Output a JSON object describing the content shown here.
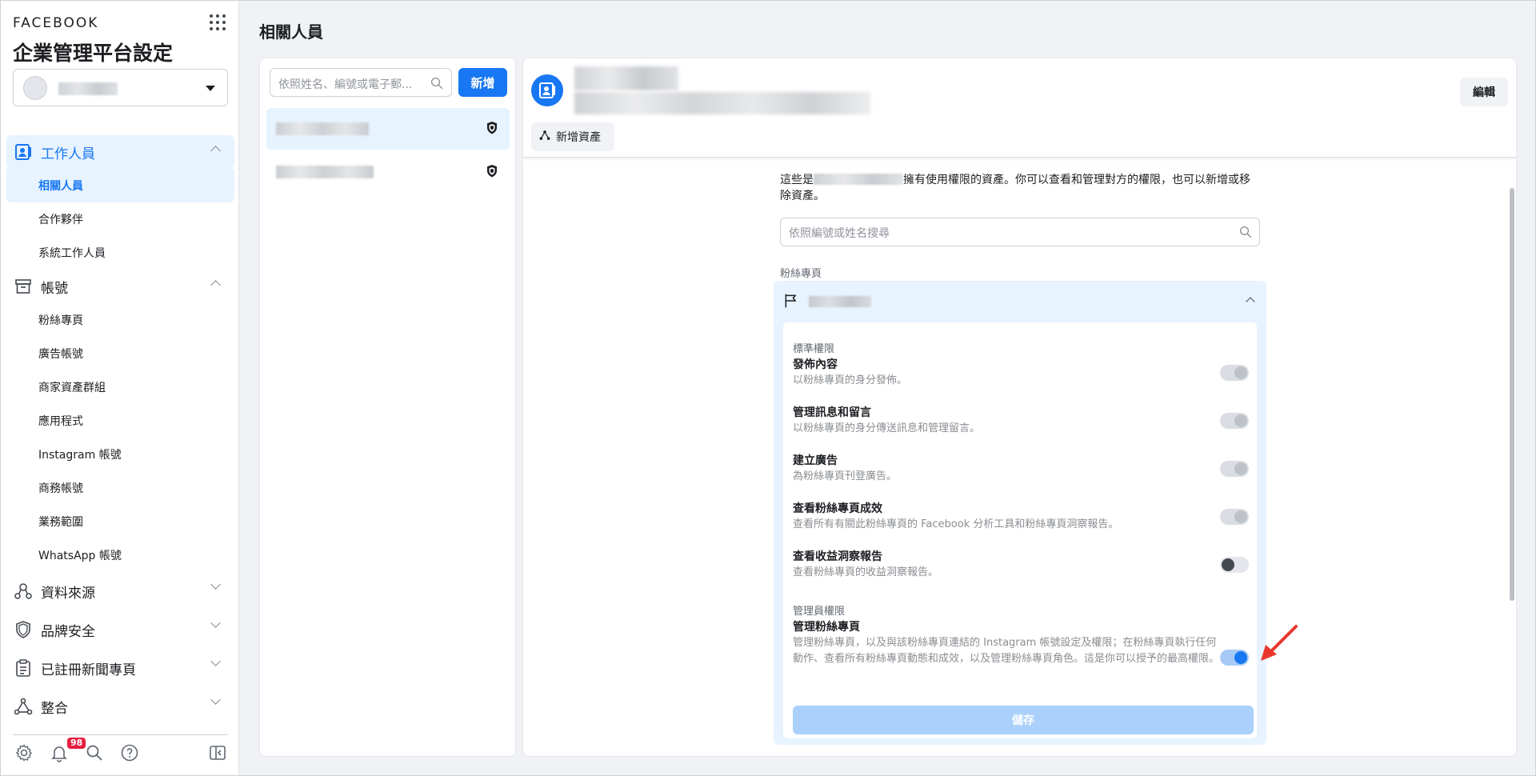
{
  "brand": "FACEBOOK",
  "settings_title": "企業管理平台設定",
  "page_title": "相關人員",
  "sidebar": {
    "groups": [
      {
        "label": "工作人員",
        "expanded": true,
        "items": [
          "相關人員",
          "合作夥伴",
          "系統工作人員"
        ],
        "active_item": "相關人員"
      },
      {
        "label": "帳號",
        "expanded": true,
        "items": [
          "粉絲專頁",
          "廣告帳號",
          "商家資產群組",
          "應用程式",
          "Instagram 帳號",
          "商務帳號",
          "業務範圍",
          "WhatsApp 帳號"
        ]
      },
      {
        "label": "資料來源",
        "expanded": false
      },
      {
        "label": "品牌安全",
        "expanded": false
      },
      {
        "label": "已註冊新聞專頁",
        "expanded": false
      },
      {
        "label": "整合",
        "expanded": false
      }
    ],
    "notification_count": "98"
  },
  "people": {
    "search_placeholder": "依照姓名、編號或電子郵...",
    "add_label": "新增"
  },
  "detail": {
    "add_asset_label": "新增資產",
    "edit_label": "編輯",
    "intro_prefix": "這些是",
    "intro_suffix": "擁有使用權限的資產。你可以查看和管理對方的權限，也可以新增或移除資產。",
    "asset_search_placeholder": "依照編號或姓名搜尋",
    "section_label": "粉絲專頁",
    "standard_heading": "標準權限",
    "admin_heading": "管理員權限",
    "permissions": [
      {
        "title": "發佈內容",
        "desc": "以粉絲專頁的身分發佈。",
        "state": "on-disabled"
      },
      {
        "title": "管理訊息和留言",
        "desc": "以粉絲專頁的身分傳送訊息和管理留言。",
        "state": "on-disabled"
      },
      {
        "title": "建立廣告",
        "desc": "為粉絲專頁刊登廣告。",
        "state": "on-disabled"
      },
      {
        "title": "查看粉絲專頁成效",
        "desc": "查看所有有關此粉絲專頁的 Facebook 分析工具和粉絲專頁洞察報告。",
        "state": "on-disabled"
      },
      {
        "title": "查看收益洞察報告",
        "desc": "查看粉絲專頁的收益洞察報告。",
        "state": "off"
      }
    ],
    "admin_permission": {
      "title": "管理粉絲專頁",
      "desc": "管理粉絲專頁，以及與該粉絲專頁連結的 Instagram 帳號設定及權限；在粉絲專頁執行任何動作、查看所有粉絲專頁動態和成效，以及管理粉絲專頁角色。這是你可以授予的最高權限。",
      "state": "on"
    },
    "save_label": "儲存"
  },
  "colors": {
    "accent": "#1877f2",
    "active_bg": "#e7f3ff",
    "arrow": "#e8382d"
  }
}
